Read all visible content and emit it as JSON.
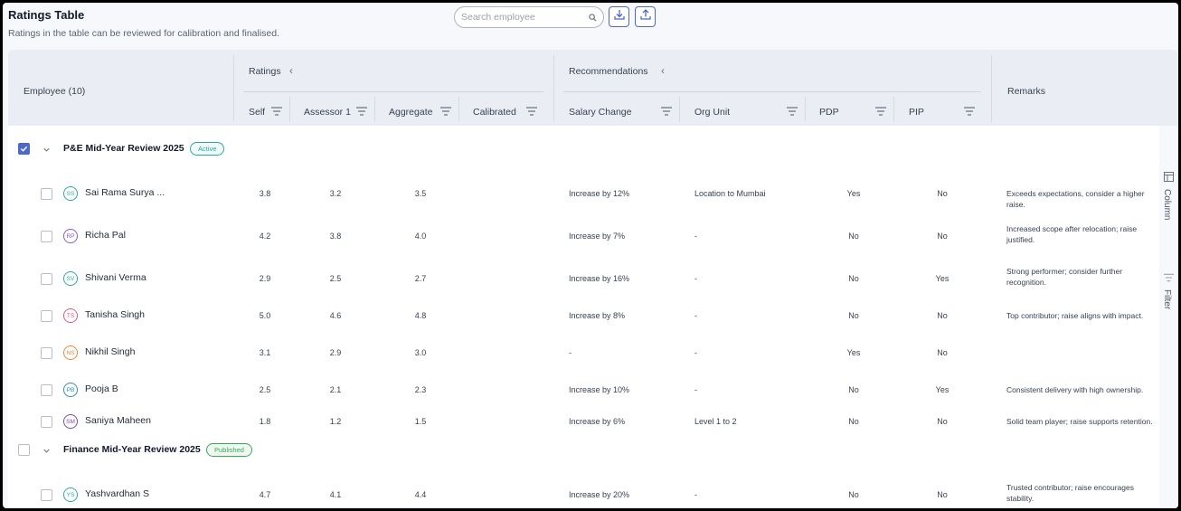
{
  "page": {
    "title": "Ratings Table",
    "subtitle": "Ratings in the table can be reviewed for calibration and finalised."
  },
  "search": {
    "placeholder": "Search employee"
  },
  "toolbar": {
    "download_icon": "download-icon",
    "upload_icon": "upload-icon"
  },
  "colors": {
    "accent": "#4a69c9",
    "active_badge": "#2fa7a0",
    "published_badge": "#3aa657"
  },
  "header": {
    "employee": "Employee (10)",
    "ratings_group": "Ratings",
    "recommendations_group": "Recommendations",
    "remarks": "Remarks",
    "columns": {
      "self": "Self",
      "assessor1": "Assessor 1",
      "aggregate": "Aggregate",
      "calibrated": "Calibrated",
      "salary_change": "Salary Change",
      "org_unit": "Org Unit",
      "pdp": "PDP",
      "pip": "PIP"
    }
  },
  "side_rail": {
    "column": "Column",
    "filter": "Filter"
  },
  "groups": [
    {
      "title": "P&E Mid-Year Review 2025",
      "badge": "Active",
      "checked": true,
      "rows": [
        {
          "initials": "SS",
          "name": "Sai Rama Surya ...",
          "self": "3.8",
          "assessor1": "3.2",
          "aggregate": "3.5",
          "calibrated": "",
          "salary_change": "Increase by 12%",
          "org_unit": "Location to Mumbai",
          "pdp": "Yes",
          "pip": "No",
          "remarks": "Exceeds expectations, consider a higher raise."
        },
        {
          "initials": "RP",
          "name": "Richa Pal",
          "self": "4.2",
          "assessor1": "3.8",
          "aggregate": "4.0",
          "calibrated": "",
          "salary_change": "Increase by 7%",
          "org_unit": "-",
          "pdp": "No",
          "pip": "No",
          "remarks": "Increased scope after relocation; raise justified."
        },
        {
          "initials": "SV",
          "name": "Shivani Verma",
          "self": "2.9",
          "assessor1": "2.5",
          "aggregate": "2.7",
          "calibrated": "",
          "salary_change": "Increase by 16%",
          "org_unit": "-",
          "pdp": "No",
          "pip": "Yes",
          "remarks": "Strong performer; consider further recognition."
        },
        {
          "initials": "TS",
          "name": "Tanisha Singh",
          "self": "5.0",
          "assessor1": "4.6",
          "aggregate": "4.8",
          "calibrated": "",
          "salary_change": "Increase by 8%",
          "org_unit": "-",
          "pdp": "No",
          "pip": "No",
          "remarks": "Top contributor; raise aligns with impact."
        },
        {
          "initials": "NS",
          "name": "Nikhil Singh",
          "self": "3.1",
          "assessor1": "2.9",
          "aggregate": "3.0",
          "calibrated": "",
          "salary_change": "-",
          "org_unit": "-",
          "pdp": "Yes",
          "pip": "No",
          "remarks": ""
        },
        {
          "initials": "PB",
          "name": "Pooja B",
          "self": "2.5",
          "assessor1": "2.1",
          "aggregate": "2.3",
          "calibrated": "",
          "salary_change": "Increase by 10%",
          "org_unit": "-",
          "pdp": "No",
          "pip": "Yes",
          "remarks": "Consistent delivery with high ownership."
        },
        {
          "initials": "SM",
          "name": "Saniya Maheen",
          "self": "1.8",
          "assessor1": "1.2",
          "aggregate": "1.5",
          "calibrated": "",
          "salary_change": "Increase by 6%",
          "org_unit": "Level 1 to 2",
          "pdp": "No",
          "pip": "No",
          "remarks": "Solid team player; raise supports retention."
        }
      ]
    },
    {
      "title": "Finance Mid-Year Review 2025",
      "badge": "Published",
      "checked": false,
      "rows": [
        {
          "initials": "YS",
          "name": "Yashvardhan S",
          "self": "4.7",
          "assessor1": "4.1",
          "aggregate": "4.4",
          "calibrated": "",
          "salary_change": "Increase by 20%",
          "org_unit": "-",
          "pdp": "No",
          "pip": "No",
          "remarks": "Trusted contributor; raise encourages stability."
        }
      ]
    }
  ]
}
